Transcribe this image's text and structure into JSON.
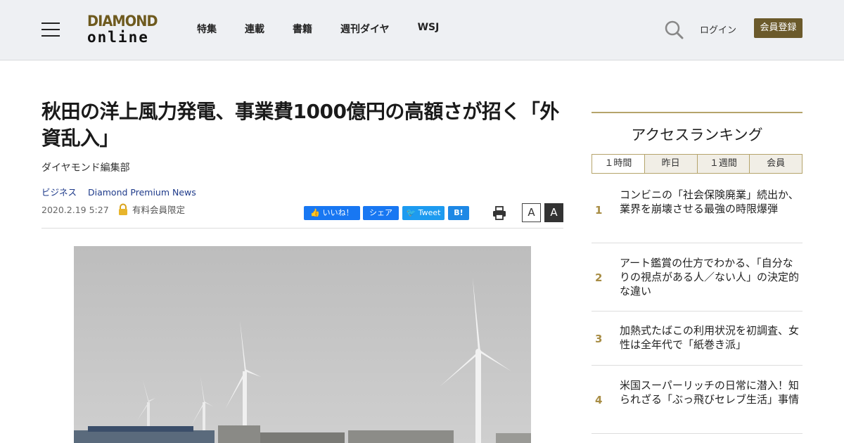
{
  "header": {
    "logo_line1": "DIAMOND",
    "logo_line2": "online",
    "nav": [
      "特集",
      "連載",
      "書籍",
      "週刊ダイヤ",
      "WSJ"
    ],
    "login": "ログイン",
    "register": "会員登録"
  },
  "article": {
    "title": "秋田の洋上風力発電、事業費1000億円の高額さが招く「外資乱入」",
    "author": "ダイヤモンド編集部",
    "tags": [
      "ビジネス",
      "Diamond Premium News"
    ],
    "date": "2020.2.19 5:27",
    "members_only": "有料会員限定",
    "share": {
      "facebook": "いいね！",
      "share": "シェア",
      "tweet": "Tweet",
      "hatena": "B!"
    },
    "font_small": "A",
    "font_large": "A"
  },
  "sidebar": {
    "ranking_title": "アクセスランキング",
    "tabs": [
      "１時間",
      "昨日",
      "１週間",
      "会員"
    ],
    "items": [
      {
        "rank": "1",
        "text": "コンビニの「社会保険廃業」続出か、業界を崩壊させる最強の時限爆弾"
      },
      {
        "rank": "2",
        "text": "アート鑑賞の仕方でわかる、「自分なりの視点がある人／ない人」の決定的な違い"
      },
      {
        "rank": "3",
        "text": "加熱式たばこの利用状況を初調査、女性は全年代で「紙巻き派」"
      },
      {
        "rank": "4",
        "text": "米国スーパーリッチの日常に潜入！知られざる「ぶっ飛びセレブ生活」事情"
      }
    ]
  },
  "colors": {
    "brand_gold": "#6b5a2b",
    "accent_line": "#b5a46b",
    "rank_number": "#a88d45",
    "facebook": "#1877f2",
    "twitter": "#1d9bf0"
  }
}
